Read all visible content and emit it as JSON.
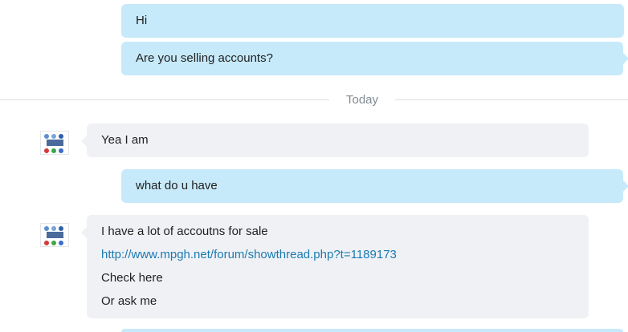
{
  "conversation": {
    "earlier": [
      {
        "text": "Hi"
      },
      {
        "text": "Are you selling accounts?"
      }
    ],
    "divider_label": "Today",
    "today": {
      "msg1": "Yea I am",
      "msg2": "what do u have",
      "msg3_lines": [
        "I have a lot of accoutns for sale",
        "http://www.mpgh.net/forum/showthread.php?t=1189173",
        "Check here",
        "Or ask me"
      ]
    }
  },
  "colors": {
    "outgoing_bubble": "#c7eafb",
    "incoming_bubble": "#f0f1f5",
    "link": "#1a7ab0"
  },
  "icons": {
    "contact_avatar": "avatar-icon"
  }
}
